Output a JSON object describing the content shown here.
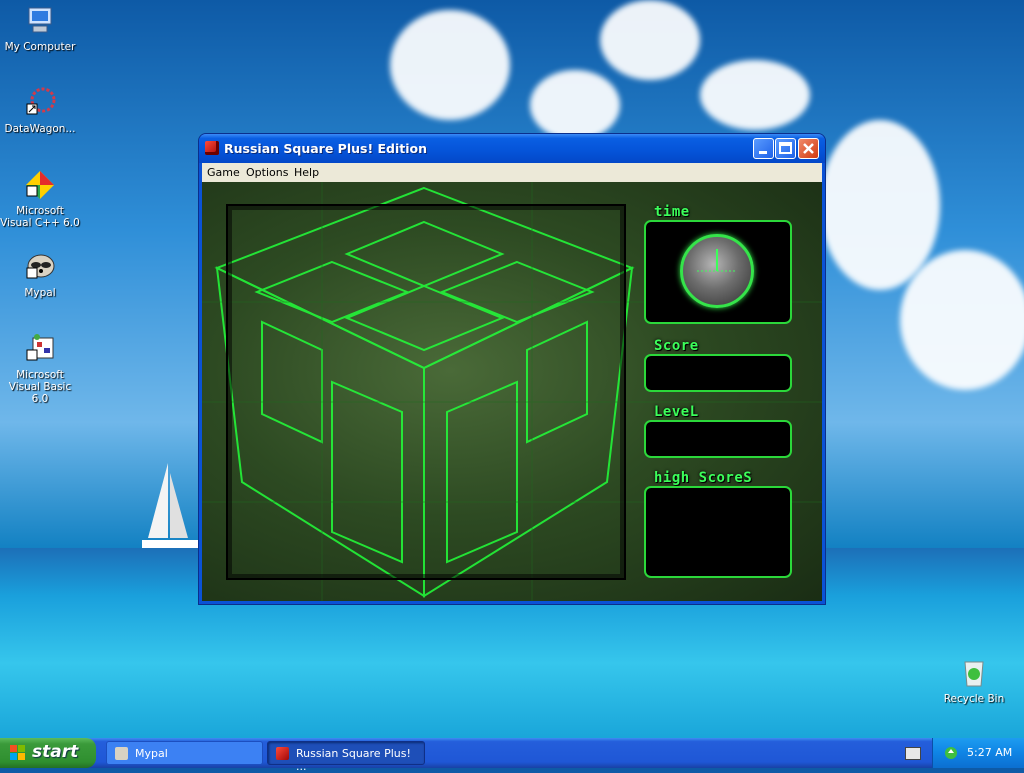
{
  "desktop": {
    "icons": [
      {
        "label": "My Computer"
      },
      {
        "label": "DataWagon..."
      },
      {
        "label": "Microsoft Visual C++ 6.0"
      },
      {
        "label": "Mypal"
      },
      {
        "label": "Microsoft Visual Basic 6.0"
      },
      {
        "label": "Recycle Bin"
      }
    ]
  },
  "window": {
    "title": "Russian Square Plus! Edition",
    "menu": [
      "Game",
      "Options",
      "Help"
    ],
    "panels": {
      "time_label": "time",
      "score_label": "Score",
      "level_label": "LeveL",
      "high_scores_label": "high ScoreS"
    }
  },
  "taskbar": {
    "start_label": "start",
    "tasks": [
      {
        "label": "Mypal"
      },
      {
        "label": "Russian Square Plus! ..."
      }
    ],
    "clock": "5:27 AM"
  },
  "colors": {
    "accent_green": "#2bd83a",
    "titlebar_blue": "#0553d8",
    "start_green": "#3a9a3a"
  }
}
